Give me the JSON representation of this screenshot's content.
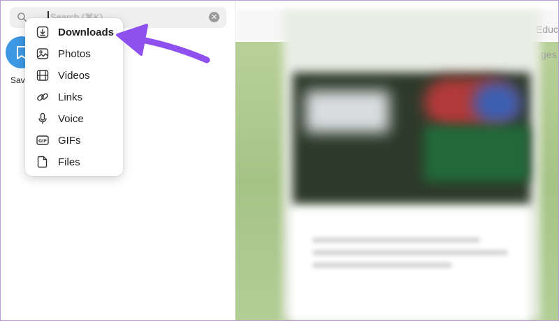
{
  "search": {
    "placeholder": "Search (⌘K)"
  },
  "chat_list": {
    "first_item_label": "Sav"
  },
  "filter_menu": {
    "items": [
      {
        "label": "Downloads",
        "icon": "download-icon"
      },
      {
        "label": "Photos",
        "icon": "photo-icon"
      },
      {
        "label": "Videos",
        "icon": "film-icon"
      },
      {
        "label": "Links",
        "icon": "link-icon"
      },
      {
        "label": "Voice",
        "icon": "microphone-icon"
      },
      {
        "label": "GIFs",
        "icon": "gif-icon"
      },
      {
        "label": "Files",
        "icon": "file-icon"
      }
    ]
  },
  "chat_header": {
    "partial_title": "Educ",
    "partial_line": "ges"
  },
  "colors": {
    "accent_purple": "#8f50f0",
    "avatar_blue": "#3d98e4",
    "chat_background": "#a9c58a"
  }
}
